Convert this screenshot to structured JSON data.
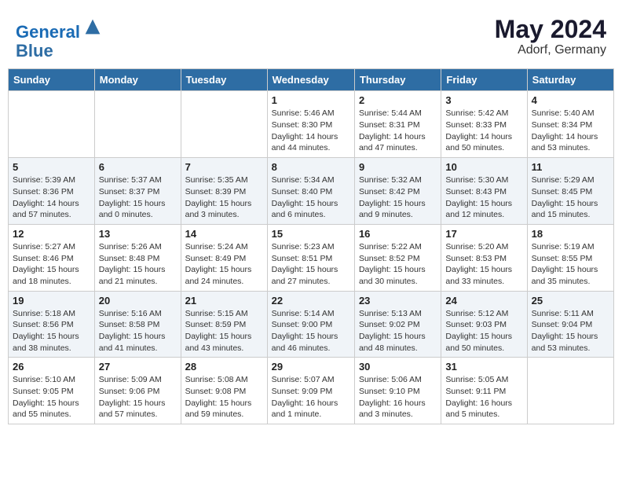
{
  "header": {
    "logo_line1": "General",
    "logo_line2": "Blue",
    "month_year": "May 2024",
    "location": "Adorf, Germany"
  },
  "days_of_week": [
    "Sunday",
    "Monday",
    "Tuesday",
    "Wednesday",
    "Thursday",
    "Friday",
    "Saturday"
  ],
  "weeks": [
    [
      {
        "day": "",
        "info": ""
      },
      {
        "day": "",
        "info": ""
      },
      {
        "day": "",
        "info": ""
      },
      {
        "day": "1",
        "info": "Sunrise: 5:46 AM\nSunset: 8:30 PM\nDaylight: 14 hours\nand 44 minutes."
      },
      {
        "day": "2",
        "info": "Sunrise: 5:44 AM\nSunset: 8:31 PM\nDaylight: 14 hours\nand 47 minutes."
      },
      {
        "day": "3",
        "info": "Sunrise: 5:42 AM\nSunset: 8:33 PM\nDaylight: 14 hours\nand 50 minutes."
      },
      {
        "day": "4",
        "info": "Sunrise: 5:40 AM\nSunset: 8:34 PM\nDaylight: 14 hours\nand 53 minutes."
      }
    ],
    [
      {
        "day": "5",
        "info": "Sunrise: 5:39 AM\nSunset: 8:36 PM\nDaylight: 14 hours\nand 57 minutes."
      },
      {
        "day": "6",
        "info": "Sunrise: 5:37 AM\nSunset: 8:37 PM\nDaylight: 15 hours\nand 0 minutes."
      },
      {
        "day": "7",
        "info": "Sunrise: 5:35 AM\nSunset: 8:39 PM\nDaylight: 15 hours\nand 3 minutes."
      },
      {
        "day": "8",
        "info": "Sunrise: 5:34 AM\nSunset: 8:40 PM\nDaylight: 15 hours\nand 6 minutes."
      },
      {
        "day": "9",
        "info": "Sunrise: 5:32 AM\nSunset: 8:42 PM\nDaylight: 15 hours\nand 9 minutes."
      },
      {
        "day": "10",
        "info": "Sunrise: 5:30 AM\nSunset: 8:43 PM\nDaylight: 15 hours\nand 12 minutes."
      },
      {
        "day": "11",
        "info": "Sunrise: 5:29 AM\nSunset: 8:45 PM\nDaylight: 15 hours\nand 15 minutes."
      }
    ],
    [
      {
        "day": "12",
        "info": "Sunrise: 5:27 AM\nSunset: 8:46 PM\nDaylight: 15 hours\nand 18 minutes."
      },
      {
        "day": "13",
        "info": "Sunrise: 5:26 AM\nSunset: 8:48 PM\nDaylight: 15 hours\nand 21 minutes."
      },
      {
        "day": "14",
        "info": "Sunrise: 5:24 AM\nSunset: 8:49 PM\nDaylight: 15 hours\nand 24 minutes."
      },
      {
        "day": "15",
        "info": "Sunrise: 5:23 AM\nSunset: 8:51 PM\nDaylight: 15 hours\nand 27 minutes."
      },
      {
        "day": "16",
        "info": "Sunrise: 5:22 AM\nSunset: 8:52 PM\nDaylight: 15 hours\nand 30 minutes."
      },
      {
        "day": "17",
        "info": "Sunrise: 5:20 AM\nSunset: 8:53 PM\nDaylight: 15 hours\nand 33 minutes."
      },
      {
        "day": "18",
        "info": "Sunrise: 5:19 AM\nSunset: 8:55 PM\nDaylight: 15 hours\nand 35 minutes."
      }
    ],
    [
      {
        "day": "19",
        "info": "Sunrise: 5:18 AM\nSunset: 8:56 PM\nDaylight: 15 hours\nand 38 minutes."
      },
      {
        "day": "20",
        "info": "Sunrise: 5:16 AM\nSunset: 8:58 PM\nDaylight: 15 hours\nand 41 minutes."
      },
      {
        "day": "21",
        "info": "Sunrise: 5:15 AM\nSunset: 8:59 PM\nDaylight: 15 hours\nand 43 minutes."
      },
      {
        "day": "22",
        "info": "Sunrise: 5:14 AM\nSunset: 9:00 PM\nDaylight: 15 hours\nand 46 minutes."
      },
      {
        "day": "23",
        "info": "Sunrise: 5:13 AM\nSunset: 9:02 PM\nDaylight: 15 hours\nand 48 minutes."
      },
      {
        "day": "24",
        "info": "Sunrise: 5:12 AM\nSunset: 9:03 PM\nDaylight: 15 hours\nand 50 minutes."
      },
      {
        "day": "25",
        "info": "Sunrise: 5:11 AM\nSunset: 9:04 PM\nDaylight: 15 hours\nand 53 minutes."
      }
    ],
    [
      {
        "day": "26",
        "info": "Sunrise: 5:10 AM\nSunset: 9:05 PM\nDaylight: 15 hours\nand 55 minutes."
      },
      {
        "day": "27",
        "info": "Sunrise: 5:09 AM\nSunset: 9:06 PM\nDaylight: 15 hours\nand 57 minutes."
      },
      {
        "day": "28",
        "info": "Sunrise: 5:08 AM\nSunset: 9:08 PM\nDaylight: 15 hours\nand 59 minutes."
      },
      {
        "day": "29",
        "info": "Sunrise: 5:07 AM\nSunset: 9:09 PM\nDaylight: 16 hours\nand 1 minute."
      },
      {
        "day": "30",
        "info": "Sunrise: 5:06 AM\nSunset: 9:10 PM\nDaylight: 16 hours\nand 3 minutes."
      },
      {
        "day": "31",
        "info": "Sunrise: 5:05 AM\nSunset: 9:11 PM\nDaylight: 16 hours\nand 5 minutes."
      },
      {
        "day": "",
        "info": ""
      }
    ]
  ]
}
